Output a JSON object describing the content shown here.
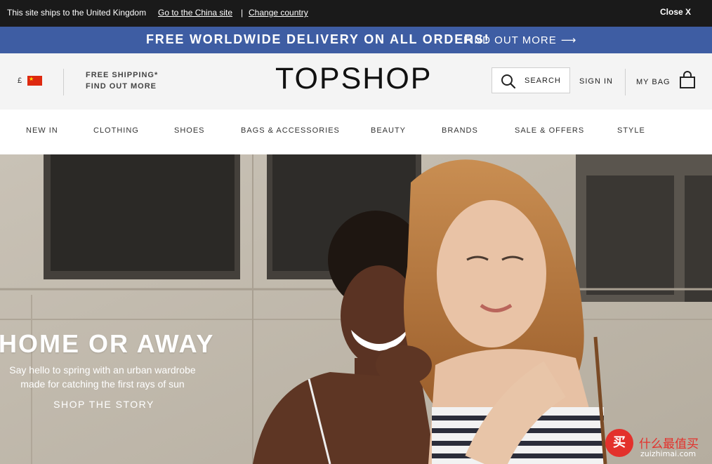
{
  "notice": {
    "text": "This site ships to the United Kingdom",
    "china_link": "Go to the China site",
    "separator": "|",
    "change_link": "Change country",
    "close_label": "Close X"
  },
  "promo": {
    "main_text": "FREE WORLDWIDE DELIVERY ON ALL ORDERS!",
    "link_text": "FIND OUT MORE",
    "arrow": "⟶"
  },
  "header": {
    "currency_symbol": "£",
    "free_shipping": "FREE SHIPPING*",
    "find_out_more": "FIND OUT MORE",
    "logo": "TOPSHOP",
    "search_label": "SEARCH",
    "sign_in": "SIGN IN",
    "my_bag": "MY BAG"
  },
  "nav": {
    "items": [
      {
        "label": "NEW IN"
      },
      {
        "label": "CLOTHING"
      },
      {
        "label": "SHOES"
      },
      {
        "label": "BAGS & ACCESSORIES"
      },
      {
        "label": "BEAUTY"
      },
      {
        "label": "BRANDS"
      },
      {
        "label": "SALE & OFFERS"
      },
      {
        "label": "STYLE"
      }
    ]
  },
  "hero": {
    "title": "HOME OR AWAY",
    "subtitle_line1": "Say hello to spring with an urban wardrobe",
    "subtitle_line2": "made for catching the first rays of sun",
    "cta": "SHOP THE STORY"
  },
  "watermark": {
    "badge": "买",
    "cn": "什么最值买",
    "en": "zuizhimai.com"
  },
  "colors": {
    "notice_bg": "#1a1a1a",
    "promo_bg": "#3e5da3",
    "header_bg": "#f4f4f4",
    "watermark_red": "#e3312c"
  },
  "icons": [
    "china-flag-icon",
    "search-icon",
    "bag-icon",
    "arrow-right-icon"
  ]
}
